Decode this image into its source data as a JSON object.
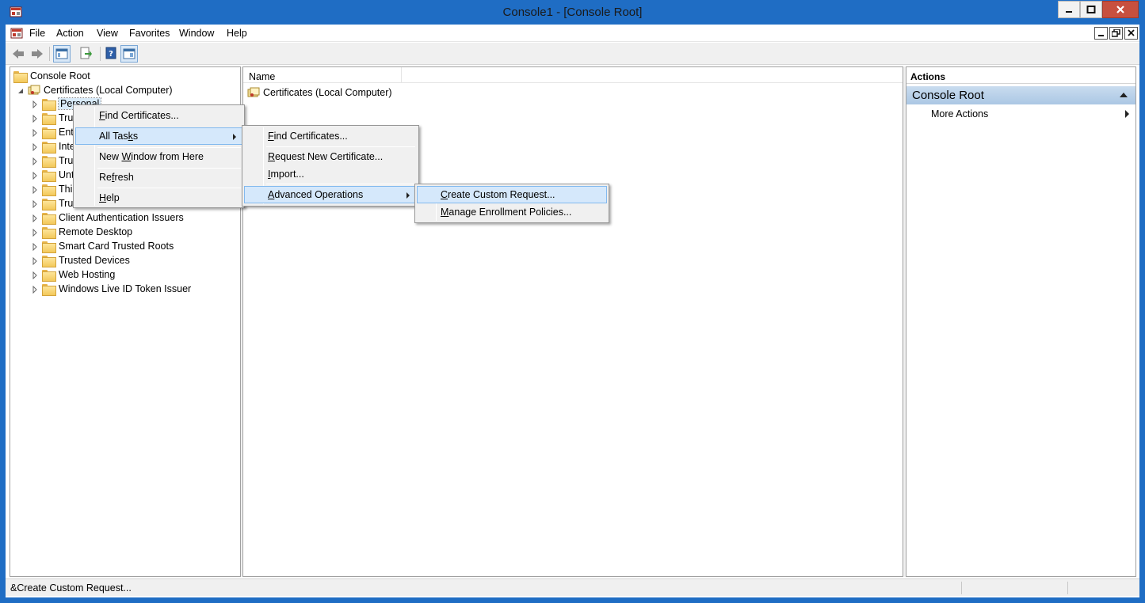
{
  "window": {
    "title": "Console1 - [Console Root]"
  },
  "menubar": {
    "items": [
      "File",
      "Action",
      "View",
      "Favorites",
      "Window",
      "Help"
    ]
  },
  "toolbar": {
    "buttons": [
      "back-icon",
      "forward-icon",
      "show-hide-console-tree-icon",
      "export-list-icon",
      "help-icon",
      "show-hide-action-pane-icon"
    ]
  },
  "tree": {
    "root": "Console Root",
    "certificates": "Certificates (Local Computer)",
    "items": [
      {
        "label": "Personal"
      },
      {
        "label": "Tru"
      },
      {
        "label": "Ent"
      },
      {
        "label": "Inte"
      },
      {
        "label": "Tru"
      },
      {
        "label": "Unt"
      },
      {
        "label": "Thi"
      },
      {
        "label": "Tru"
      },
      {
        "label": "Client Authentication Issuers"
      },
      {
        "label": "Remote Desktop"
      },
      {
        "label": "Smart Card Trusted Roots"
      },
      {
        "label": "Trusted Devices"
      },
      {
        "label": "Web Hosting"
      },
      {
        "label": "Windows Live ID Token Issuer"
      }
    ]
  },
  "center": {
    "column_name": "Name",
    "rows": [
      "Certificates (Local Computer)"
    ]
  },
  "actions": {
    "header": "Actions",
    "group": "Console Root",
    "item": "More Actions"
  },
  "context_menu": {
    "find_a": "F",
    "find_b": "ind Certificates...",
    "alltasks_a": "All Tas",
    "alltasks_b": "k",
    "alltasks_c": "s",
    "newwin_a": "New ",
    "newwin_b": "W",
    "newwin_c": "indow from Here",
    "refresh_a": "Re",
    "refresh_b": "f",
    "refresh_c": "resh",
    "help_a": "H",
    "help_b": "elp"
  },
  "submenu_alltasks": {
    "find_a": "F",
    "find_b": "ind Certificates...",
    "request_a": "R",
    "request_b": "equest New Certificate...",
    "import_a": "I",
    "import_b": "mport...",
    "advanced_a": "A",
    "advanced_b": "dvanced Operations"
  },
  "submenu_advanced": {
    "create_a": "C",
    "create_b": "reate Custom Request...",
    "manage_a": "M",
    "manage_b": "anage Enrollment Policies..."
  },
  "status": {
    "text": "&Create Custom Request..."
  },
  "colors": {
    "title_bar": "#1f6dc4",
    "highlight": "#d5e8fb",
    "highlight_border": "#82b9ee",
    "actions_group": "#b8d1ea"
  }
}
